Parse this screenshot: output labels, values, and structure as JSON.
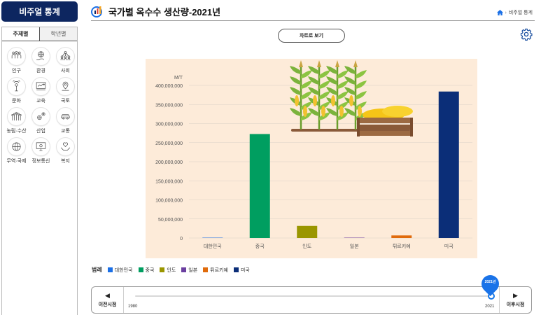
{
  "sidebar": {
    "title": "비주얼 통계",
    "tabs": [
      {
        "label": "주제별",
        "active": true
      },
      {
        "label": "학년별",
        "active": false
      }
    ],
    "categories": [
      {
        "label": "인구",
        "icon": "people-icon"
      },
      {
        "label": "환경",
        "icon": "globe-hand-icon"
      },
      {
        "label": "사회",
        "icon": "network-icon"
      },
      {
        "label": "문화",
        "icon": "broadcast-icon"
      },
      {
        "label": "교육",
        "icon": "graduation-icon"
      },
      {
        "label": "국토",
        "icon": "location-pin-icon"
      },
      {
        "label": "농림·수산",
        "icon": "farm-icon"
      },
      {
        "label": "산업",
        "icon": "gears-icon"
      },
      {
        "label": "교통",
        "icon": "car-icon"
      },
      {
        "label": "무역·국제",
        "icon": "world-icon"
      },
      {
        "label": "정보통신",
        "icon": "computer-icon"
      },
      {
        "label": "복지",
        "icon": "heart-hands-icon"
      }
    ]
  },
  "header": {
    "title": "국가별 옥수수 생산량-2021년",
    "breadcrumb": "비주얼 통계"
  },
  "controls": {
    "chart_view_label": "차트로 보기"
  },
  "chart_data": {
    "type": "bar",
    "ylabel": "M/T",
    "ylim": [
      0,
      400000000
    ],
    "yticks": [
      "0",
      "50,000,000",
      "100,000,000",
      "150,000,000",
      "200,000,000",
      "250,000,000",
      "300,000,000",
      "350,000,000",
      "400,000,000"
    ],
    "categories": [
      "대한민국",
      "중국",
      "인도",
      "일본",
      "튀르키예",
      "미국"
    ],
    "values": [
      75000,
      272550000,
      31650000,
      200,
      6750000,
      383940000
    ],
    "colors": [
      "#1a6fe6",
      "#009e60",
      "#9a9600",
      "#6b3fa0",
      "#e06b0c",
      "#0b2e78"
    ],
    "background": "#fdebd9",
    "illustration": "corn-field-icon"
  },
  "legend": {
    "title": "범례"
  },
  "timeline": {
    "prev_label": "이전시점",
    "next_label": "이후시점",
    "start_year": "1980",
    "end_year": "2021",
    "current_year": "2021년",
    "accent": "#1a73e8"
  }
}
